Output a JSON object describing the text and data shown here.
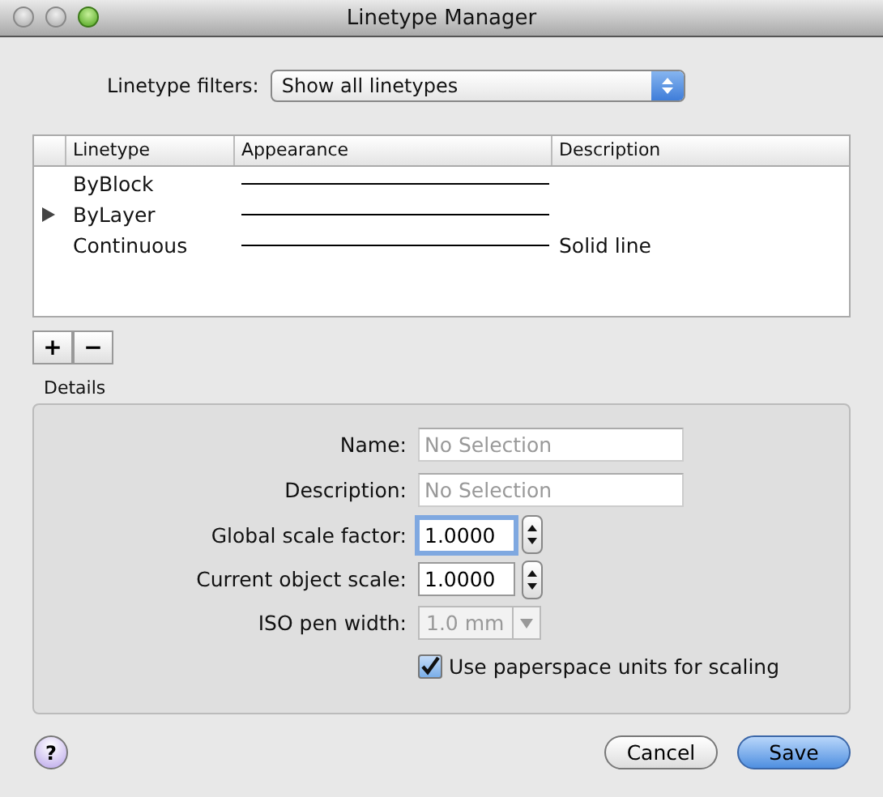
{
  "window": {
    "title": "Linetype Manager"
  },
  "filter": {
    "label": "Linetype filters:",
    "value": "Show all linetypes"
  },
  "table": {
    "columns": [
      "Linetype",
      "Appearance",
      "Description"
    ],
    "rows": [
      {
        "linetype": "ByBlock",
        "description": "",
        "current": false
      },
      {
        "linetype": "ByLayer",
        "description": "",
        "current": true
      },
      {
        "linetype": "Continuous",
        "description": "Solid line",
        "current": false
      }
    ]
  },
  "list_buttons": [
    "+",
    "−"
  ],
  "details": {
    "title": "Details",
    "fields": [
      {
        "kind": "text",
        "label": "Name:",
        "placeholder": "No Selection"
      },
      {
        "kind": "text",
        "label": "Description:",
        "placeholder": "No Selection"
      },
      {
        "kind": "stepper",
        "label": "Global scale factor:",
        "value": "1.0000",
        "focused": true
      },
      {
        "kind": "stepper",
        "label": "Current object scale:",
        "value": "1.0000",
        "focused": false
      },
      {
        "kind": "select",
        "label": "ISO pen width:",
        "value": "1.0 mm",
        "disabled": true
      }
    ],
    "checkbox": {
      "label": "Use paperspace units for scaling",
      "checked": true
    }
  },
  "help": "?",
  "buttons": [
    {
      "label": "Cancel",
      "default": false
    },
    {
      "label": "Save",
      "default": true
    }
  ]
}
